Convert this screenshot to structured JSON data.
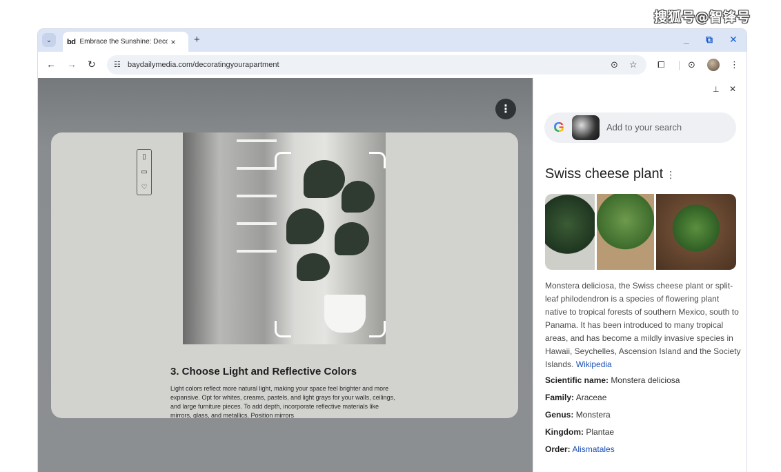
{
  "watermark": "搜狐号@智锋号",
  "browser": {
    "tab_title": "Embrace the Sunshine: Deco",
    "favicon_text": "bd",
    "tab_close": "×",
    "new_tab": "+",
    "url": "baydailymedia.com/decoratingyourapartment",
    "window_controls": [
      "_",
      "⧉",
      "✕"
    ]
  },
  "article": {
    "heading": "3. Choose Light and Reflective Colors",
    "body": "Light colors reflect more natural light, making your space feel brighter and more expansive. Opt for whites, creams, pastels, and light grays for your walls, ceilings, and large furniture pieces. To add depth, incorporate reflective materials like mirrors, glass, and metallics. Position mirrors"
  },
  "side_panel": {
    "search_placeholder": "Add to your search",
    "result_title": "Swiss cheese plant",
    "description_text": "Monstera deliciosa, the Swiss cheese plant or split-leaf philodendron is a species of flowering plant native to tropical forests of southern Mexico, south to Panama. It has been introduced to many tropical areas, and has become a mildly invasive species in Hawaii, Seychelles, Ascension Island and the Society Islands.",
    "description_link": "Wikipedia",
    "facts": [
      {
        "label": "Scientific name:",
        "value": "Monstera deliciosa",
        "is_link": false
      },
      {
        "label": "Family:",
        "value": "Araceae",
        "is_link": false
      },
      {
        "label": "Genus:",
        "value": "Monstera",
        "is_link": false
      },
      {
        "label": "Kingdom:",
        "value": "Plantae",
        "is_link": false
      },
      {
        "label": "Order:",
        "value": "Alismatales",
        "is_link": true
      }
    ]
  },
  "icons": [
    "chevron-down-icon",
    "back-arrow-icon",
    "forward-arrow-icon",
    "reload-icon",
    "site-info-icon",
    "lens-icon",
    "star-icon",
    "extensions-icon",
    "profile-avatar",
    "more-vert-icon",
    "pin-icon",
    "close-icon",
    "bookmark-icon",
    "comment-icon",
    "heart-icon"
  ],
  "colors": {
    "link": "#1a4fb8",
    "accent": "#1a5fd0",
    "tabstrip": "#dce5f5"
  }
}
